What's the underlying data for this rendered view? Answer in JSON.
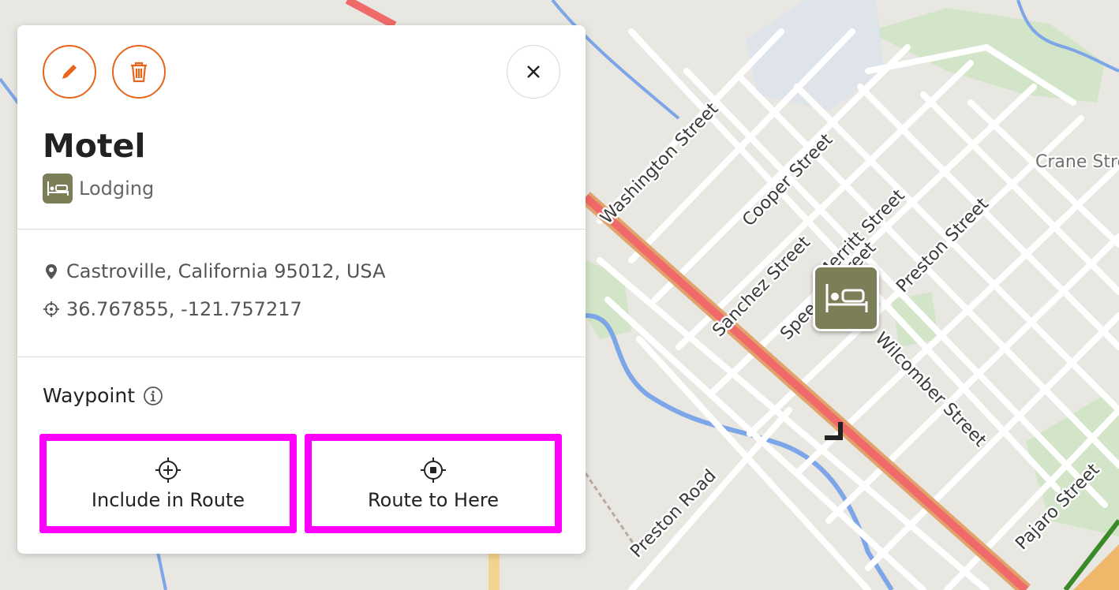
{
  "poi": {
    "title": "Motel",
    "category": "Lodging",
    "address": "Castroville, California 95012, USA",
    "coordinates": "36.767855, -121.757217"
  },
  "toolbar": {
    "edit_icon": "pencil-icon",
    "delete_icon": "trash-icon",
    "close_icon": "close-icon"
  },
  "waypoint": {
    "heading": "Waypoint",
    "include_label": "Include in Route",
    "route_here_label": "Route to Here"
  },
  "map": {
    "streets": {
      "washington": "Washington Street",
      "cooper": "Cooper Street",
      "sanchez": "Sanchez Street",
      "speegle": "Speegle Street",
      "preston": "Preston Street",
      "merritt": "Merritt Street",
      "wilcomber": "Wilcomber Street",
      "preston_road": "Preston Road",
      "pajaro": "Pajaro Street",
      "crane": "Crane Street"
    }
  },
  "colors": {
    "accent": "#e8641b",
    "highlight": "#ff00ff",
    "lodging": "#7b7e57",
    "highway": "#f06a6a"
  }
}
